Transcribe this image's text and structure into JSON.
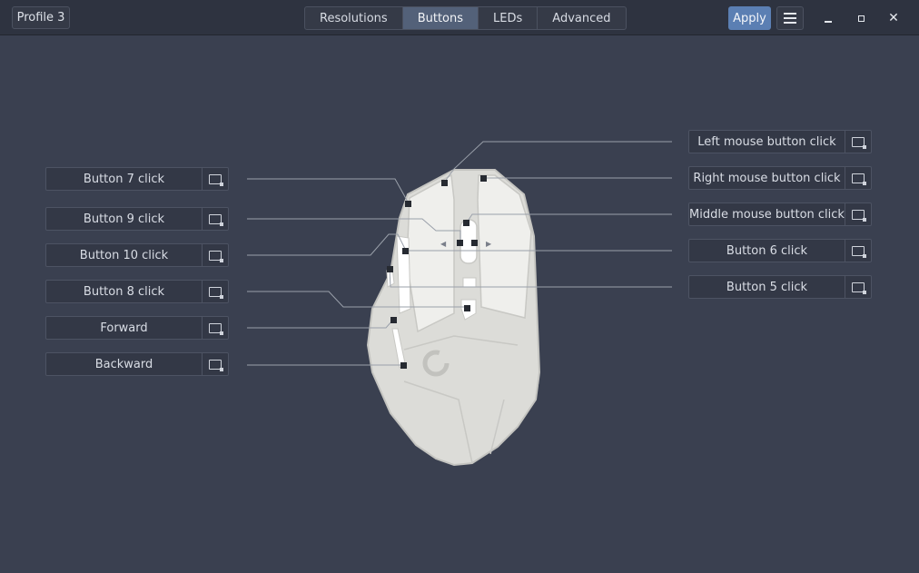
{
  "header": {
    "profile": "Profile 3",
    "tabs": [
      "Resolutions",
      "Buttons",
      "LEDs",
      "Advanced"
    ],
    "active_tab": "Buttons",
    "apply": "Apply"
  },
  "left_buttons": [
    {
      "label": "Button 7 click"
    },
    {
      "label": "Button 9 click"
    },
    {
      "label": "Button 10 click"
    },
    {
      "label": "Button 8 click"
    },
    {
      "label": "Forward"
    },
    {
      "label": "Backward"
    }
  ],
  "right_buttons": [
    {
      "label": "Left mouse button click"
    },
    {
      "label": "Right mouse button click"
    },
    {
      "label": "Middle mouse button click"
    },
    {
      "label": "Button 6 click"
    },
    {
      "label": "Button 5 click"
    }
  ],
  "colors": {
    "background": "#3a4050",
    "accent": "#5b7fb3",
    "mouse_body": "#dcdcd8"
  }
}
